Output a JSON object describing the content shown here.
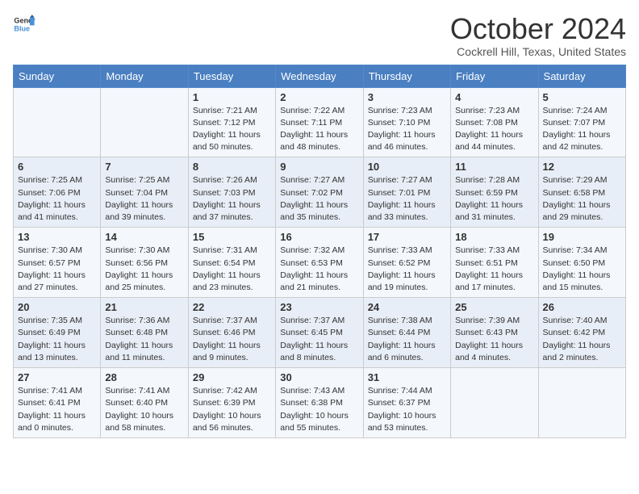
{
  "header": {
    "logo_line1": "General",
    "logo_line2": "Blue",
    "month_title": "October 2024",
    "location": "Cockrell Hill, Texas, United States"
  },
  "weekdays": [
    "Sunday",
    "Monday",
    "Tuesday",
    "Wednesday",
    "Thursday",
    "Friday",
    "Saturday"
  ],
  "weeks": [
    [
      {
        "day": "",
        "info": ""
      },
      {
        "day": "",
        "info": ""
      },
      {
        "day": "1",
        "info": "Sunrise: 7:21 AM\nSunset: 7:12 PM\nDaylight: 11 hours and 50 minutes."
      },
      {
        "day": "2",
        "info": "Sunrise: 7:22 AM\nSunset: 7:11 PM\nDaylight: 11 hours and 48 minutes."
      },
      {
        "day": "3",
        "info": "Sunrise: 7:23 AM\nSunset: 7:10 PM\nDaylight: 11 hours and 46 minutes."
      },
      {
        "day": "4",
        "info": "Sunrise: 7:23 AM\nSunset: 7:08 PM\nDaylight: 11 hours and 44 minutes."
      },
      {
        "day": "5",
        "info": "Sunrise: 7:24 AM\nSunset: 7:07 PM\nDaylight: 11 hours and 42 minutes."
      }
    ],
    [
      {
        "day": "6",
        "info": "Sunrise: 7:25 AM\nSunset: 7:06 PM\nDaylight: 11 hours and 41 minutes."
      },
      {
        "day": "7",
        "info": "Sunrise: 7:25 AM\nSunset: 7:04 PM\nDaylight: 11 hours and 39 minutes."
      },
      {
        "day": "8",
        "info": "Sunrise: 7:26 AM\nSunset: 7:03 PM\nDaylight: 11 hours and 37 minutes."
      },
      {
        "day": "9",
        "info": "Sunrise: 7:27 AM\nSunset: 7:02 PM\nDaylight: 11 hours and 35 minutes."
      },
      {
        "day": "10",
        "info": "Sunrise: 7:27 AM\nSunset: 7:01 PM\nDaylight: 11 hours and 33 minutes."
      },
      {
        "day": "11",
        "info": "Sunrise: 7:28 AM\nSunset: 6:59 PM\nDaylight: 11 hours and 31 minutes."
      },
      {
        "day": "12",
        "info": "Sunrise: 7:29 AM\nSunset: 6:58 PM\nDaylight: 11 hours and 29 minutes."
      }
    ],
    [
      {
        "day": "13",
        "info": "Sunrise: 7:30 AM\nSunset: 6:57 PM\nDaylight: 11 hours and 27 minutes."
      },
      {
        "day": "14",
        "info": "Sunrise: 7:30 AM\nSunset: 6:56 PM\nDaylight: 11 hours and 25 minutes."
      },
      {
        "day": "15",
        "info": "Sunrise: 7:31 AM\nSunset: 6:54 PM\nDaylight: 11 hours and 23 minutes."
      },
      {
        "day": "16",
        "info": "Sunrise: 7:32 AM\nSunset: 6:53 PM\nDaylight: 11 hours and 21 minutes."
      },
      {
        "day": "17",
        "info": "Sunrise: 7:33 AM\nSunset: 6:52 PM\nDaylight: 11 hours and 19 minutes."
      },
      {
        "day": "18",
        "info": "Sunrise: 7:33 AM\nSunset: 6:51 PM\nDaylight: 11 hours and 17 minutes."
      },
      {
        "day": "19",
        "info": "Sunrise: 7:34 AM\nSunset: 6:50 PM\nDaylight: 11 hours and 15 minutes."
      }
    ],
    [
      {
        "day": "20",
        "info": "Sunrise: 7:35 AM\nSunset: 6:49 PM\nDaylight: 11 hours and 13 minutes."
      },
      {
        "day": "21",
        "info": "Sunrise: 7:36 AM\nSunset: 6:48 PM\nDaylight: 11 hours and 11 minutes."
      },
      {
        "day": "22",
        "info": "Sunrise: 7:37 AM\nSunset: 6:46 PM\nDaylight: 11 hours and 9 minutes."
      },
      {
        "day": "23",
        "info": "Sunrise: 7:37 AM\nSunset: 6:45 PM\nDaylight: 11 hours and 8 minutes."
      },
      {
        "day": "24",
        "info": "Sunrise: 7:38 AM\nSunset: 6:44 PM\nDaylight: 11 hours and 6 minutes."
      },
      {
        "day": "25",
        "info": "Sunrise: 7:39 AM\nSunset: 6:43 PM\nDaylight: 11 hours and 4 minutes."
      },
      {
        "day": "26",
        "info": "Sunrise: 7:40 AM\nSunset: 6:42 PM\nDaylight: 11 hours and 2 minutes."
      }
    ],
    [
      {
        "day": "27",
        "info": "Sunrise: 7:41 AM\nSunset: 6:41 PM\nDaylight: 11 hours and 0 minutes."
      },
      {
        "day": "28",
        "info": "Sunrise: 7:41 AM\nSunset: 6:40 PM\nDaylight: 10 hours and 58 minutes."
      },
      {
        "day": "29",
        "info": "Sunrise: 7:42 AM\nSunset: 6:39 PM\nDaylight: 10 hours and 56 minutes."
      },
      {
        "day": "30",
        "info": "Sunrise: 7:43 AM\nSunset: 6:38 PM\nDaylight: 10 hours and 55 minutes."
      },
      {
        "day": "31",
        "info": "Sunrise: 7:44 AM\nSunset: 6:37 PM\nDaylight: 10 hours and 53 minutes."
      },
      {
        "day": "",
        "info": ""
      },
      {
        "day": "",
        "info": ""
      }
    ]
  ]
}
